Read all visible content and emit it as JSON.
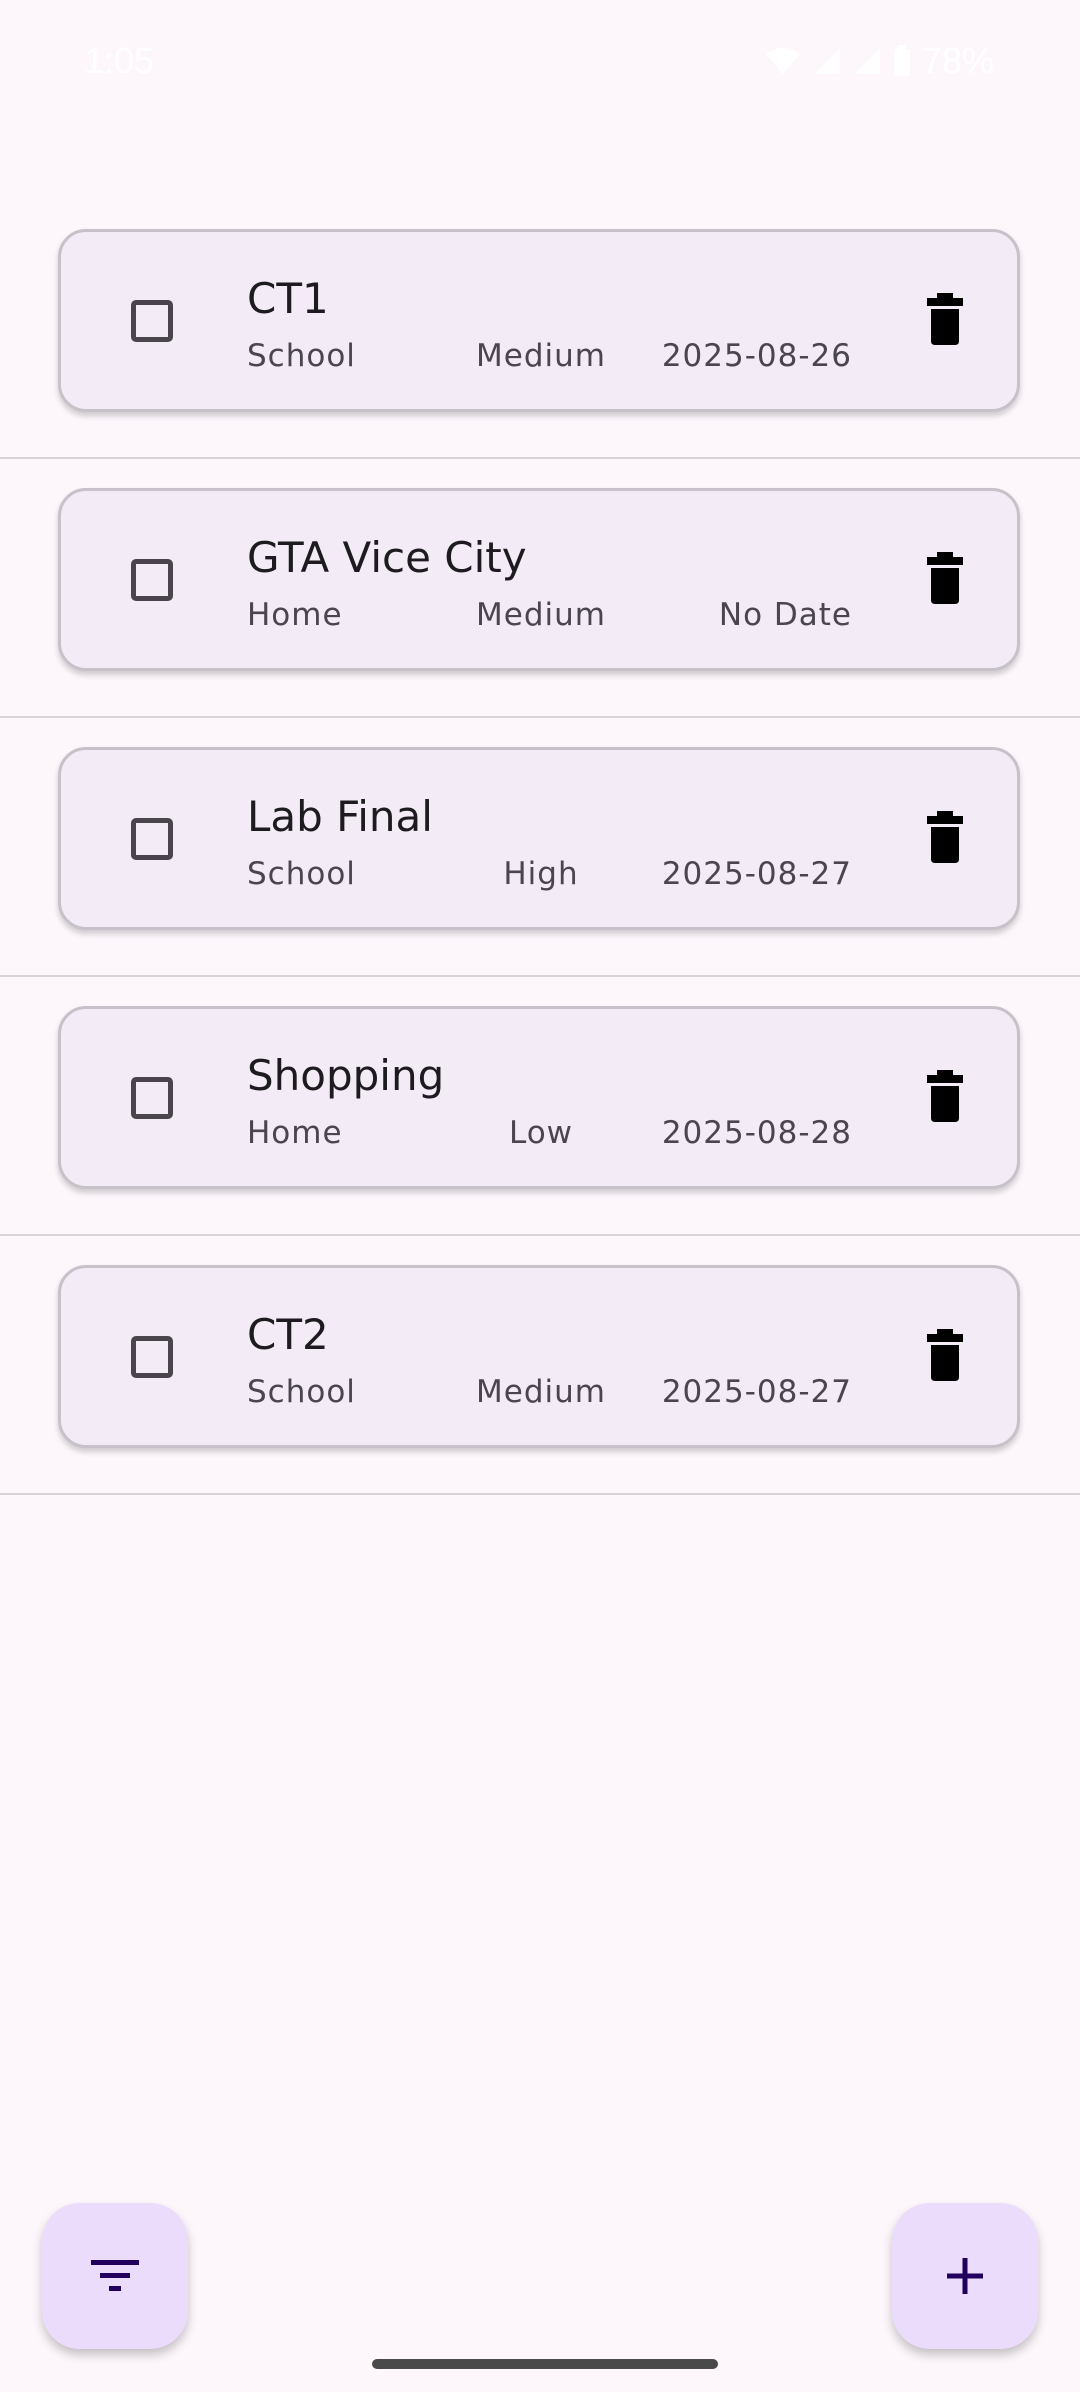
{
  "status_bar": {
    "time": "1:05",
    "battery": "78%"
  },
  "tasks": [
    {
      "title": "CT1",
      "category": "School",
      "priority": "Medium",
      "date": "2025-08-26"
    },
    {
      "title": "GTA Vice City",
      "category": "Home",
      "priority": "Medium",
      "date": "No Date"
    },
    {
      "title": "Lab Final",
      "category": "School",
      "priority": "High",
      "date": "2025-08-27"
    },
    {
      "title": "Shopping",
      "category": "Home",
      "priority": "Low",
      "date": "2025-08-28"
    },
    {
      "title": "CT2",
      "category": "School",
      "priority": "Medium",
      "date": "2025-08-27"
    }
  ],
  "icons": {
    "row_toggle": "checkbox-icon",
    "row_delete": "trash-icon",
    "filter": "filter-icon",
    "add": "plus-icon"
  },
  "colors": {
    "background": "#fdf7fc",
    "card": "#f3ebf5",
    "fab": "#ebdcfb",
    "fab_icon": "#21005d"
  }
}
